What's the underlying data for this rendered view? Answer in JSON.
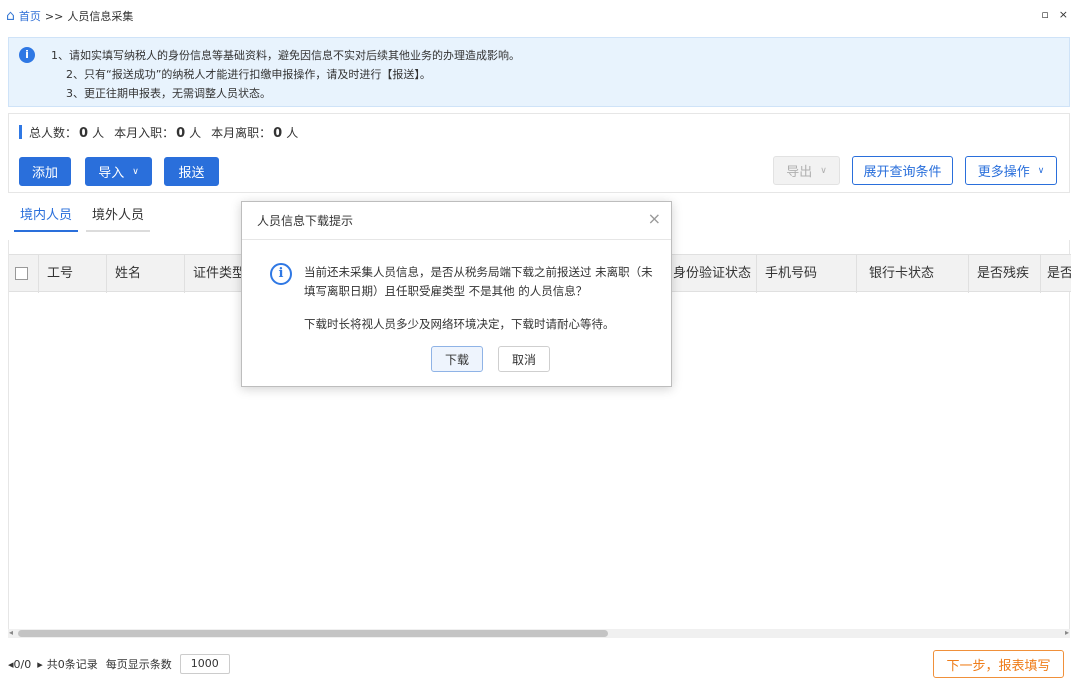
{
  "breadcrumb": {
    "home_label": "首页",
    "separator": ">>",
    "current": "人员信息采集"
  },
  "window_controls": {
    "restore_glyph": "▫",
    "close_glyph": "×"
  },
  "notice": {
    "icon": "i",
    "lines": [
      "1、请如实填写纳税人的身份信息等基础资料，避免因信息不实对后续其他业务的办理造成影响。",
      "2、只有“报送成功”的纳税人才能进行扣缴申报操作，请及时进行【报送】。",
      "3、更正往期申报表，无需调整人员状态。"
    ]
  },
  "stats": {
    "total_label": "总人数：",
    "total_value": "0",
    "total_unit": "人",
    "join_label": "本月入职：",
    "join_value": "0",
    "join_unit": "人",
    "leave_label": "本月离职：",
    "leave_value": "0",
    "leave_unit": "人"
  },
  "toolbar": {
    "add": "添加",
    "import": "导入",
    "submit": "报送",
    "export": "导出",
    "expand_query": "展开查询条件",
    "more_ops": "更多操作"
  },
  "tabs": [
    {
      "label": "境内人员",
      "active": true
    },
    {
      "label": "境外人员",
      "active": false
    }
  ],
  "table": {
    "columns": [
      "工号",
      "姓名",
      "证件类型",
      "身份验证状态",
      "手机号码",
      "银行卡状态",
      "是否残疾",
      "是否"
    ]
  },
  "pagination": {
    "page": "0/0",
    "total_records": "共0条记录",
    "per_page_label": "每页显示条数",
    "per_page_value": "1000"
  },
  "next_button": "下一步，报表填写",
  "dialog": {
    "title": "人员信息下载提示",
    "close_glyph": "×",
    "icon": "i",
    "message": "当前还未采集人员信息，是否从税务局端下载之前报送过 未离职（未填写离职日期）且任职受雇类型 不是其他 的人员信息？",
    "note": "下载时长将视人员多少及网络环境决定，下载时请耐心等待。",
    "confirm": "下载",
    "cancel": "取消"
  },
  "colors": {
    "primary": "#2a6fdb",
    "notice_bg": "#e8f3fd",
    "next_button": "#ef7d1a"
  }
}
